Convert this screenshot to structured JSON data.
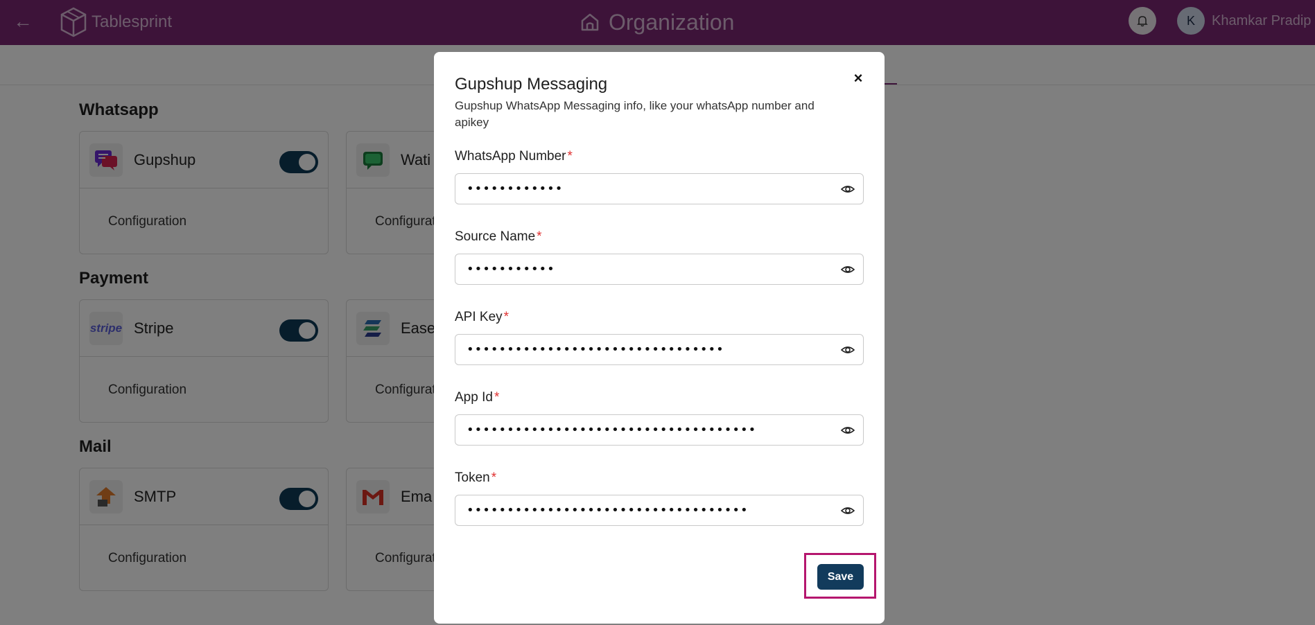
{
  "header": {
    "back_icon": "arrow-left-icon",
    "logo_text": "Tablesprint",
    "title": "Organization",
    "title_icon": "home-icon",
    "bell_icon": "bell-icon",
    "user_initial": "K",
    "user_name": "Khamkar Pradip",
    "color": "#7a2673"
  },
  "sections": {
    "whatsapp": {
      "title": "Whatsapp",
      "cards": [
        {
          "name": "Gupshup",
          "config": "Configuration",
          "toggle_on": true,
          "icon": "gupshup-chat-icon"
        },
        {
          "name": "Wati",
          "config": "Configuration",
          "icon": "wati-chat-icon"
        }
      ]
    },
    "payment": {
      "title": "Payment",
      "cards": [
        {
          "name": "Stripe",
          "config": "Configuration",
          "toggle_on": true,
          "icon": "stripe-logo-icon",
          "icon_text": "stripe"
        },
        {
          "name": "Ease",
          "config": "Configuration",
          "icon": "easebuzz-logo-icon"
        }
      ]
    },
    "mail": {
      "title": "Mail",
      "cards": [
        {
          "name": "SMTP",
          "config": "Configuration",
          "toggle_on": true,
          "icon": "smtp-icon"
        },
        {
          "name": "Ema",
          "config": "Configuration",
          "icon": "gmail-icon"
        }
      ]
    }
  },
  "modal": {
    "title": "Gupshup Messaging",
    "description": "Gupshup WhatsApp Messaging info, like your whatsApp number and apikey",
    "close_icon": "close-icon",
    "fields": [
      {
        "label": "WhatsApp Number",
        "required_mark": "*",
        "value": "••••••••••••"
      },
      {
        "label": "Source Name",
        "required_mark": "*",
        "value": "•••••••••••"
      },
      {
        "label": "API Key",
        "required_mark": "*",
        "value": "••••••••••••••••••••••••••••••••"
      },
      {
        "label": "App Id",
        "required_mark": "*",
        "value": "••••••••••••••••••••••••••••••••••••"
      },
      {
        "label": "Token",
        "required_mark": "*",
        "value": "•••••••••••••••••••••••••••••••••••"
      }
    ],
    "eye_icon": "eye-icon",
    "save_label": "Save",
    "save_color": "#123b5c",
    "highlight_color": "#b5166e"
  }
}
